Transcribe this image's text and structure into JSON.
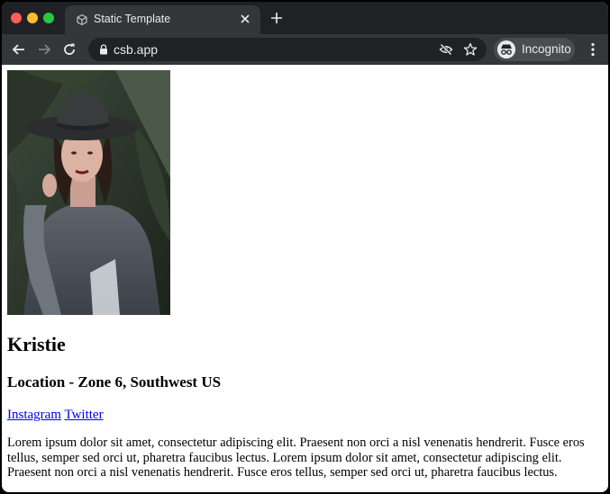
{
  "browser": {
    "tab_title": "Static Template",
    "url": "csb.app",
    "profile_label": "Incognito"
  },
  "page": {
    "name": "Kristie",
    "location": "Location - Zone 6, Southwest US",
    "links": [
      {
        "label": "Instagram"
      },
      {
        "label": "Twitter"
      }
    ],
    "bio": "Lorem ipsum dolor sit amet, consectetur adipiscing elit. Praesent non orci a nisl venenatis hendrerit. Fusce eros tellus, semper sed orci ut, pharetra faucibus lectus. Lorem ipsum dolor sit amet, consectetur adipiscing elit. Praesent non orci a nisl venenatis hendrerit. Fusce eros tellus, semper sed orci ut, pharetra faucibus lectus."
  },
  "icons": {
    "window_controls": [
      "close-dot",
      "minimize-dot",
      "maximize-dot"
    ],
    "tab": [
      "codesandbox-favicon-icon",
      "close-tab-icon"
    ],
    "toolbar": [
      "back-arrow-icon",
      "forward-arrow-icon",
      "reload-icon",
      "lock-icon",
      "eye-slash-icon",
      "star-icon",
      "incognito-icon",
      "kebab-menu-icon"
    ]
  },
  "colors": {
    "titlebar": "#202124",
    "toolbar": "#35363a",
    "link": "#0000ee"
  }
}
